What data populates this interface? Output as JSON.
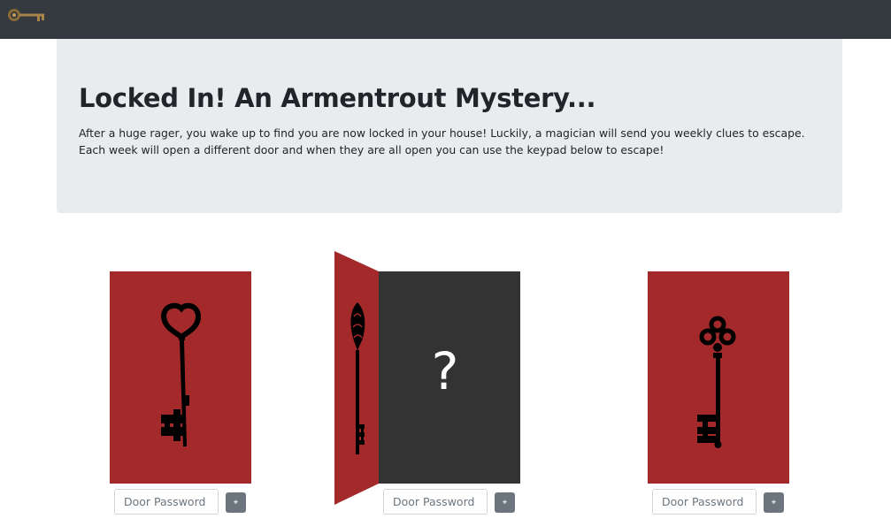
{
  "navbar": {
    "logo_icon": "skeleton-key-icon",
    "background": "#343a40"
  },
  "jumbotron": {
    "title": "Locked In! An Armentrout Mystery...",
    "description": "After a huge rager, you wake up to find you are now locked in your house! Luckily, a magician will send you weekly clues to escape. Each week will open a different door and when they are all open you can use the keypad below to escape!"
  },
  "doors": [
    {
      "state": "closed",
      "icon": "heart-key-icon",
      "placeholder": "Door Password",
      "button_icon": "unlock-icon"
    },
    {
      "state": "open",
      "icon": "ornate-key-icon",
      "revealed": "?",
      "placeholder": "Door Password",
      "button_icon": "unlock-icon"
    },
    {
      "state": "closed",
      "icon": "clover-key-icon",
      "placeholder": "Door Password",
      "button_icon": "unlock-icon"
    }
  ],
  "colors": {
    "door_red": "#a3292b",
    "door_open_inside": "#333333",
    "button_gray": "#6c757d"
  }
}
